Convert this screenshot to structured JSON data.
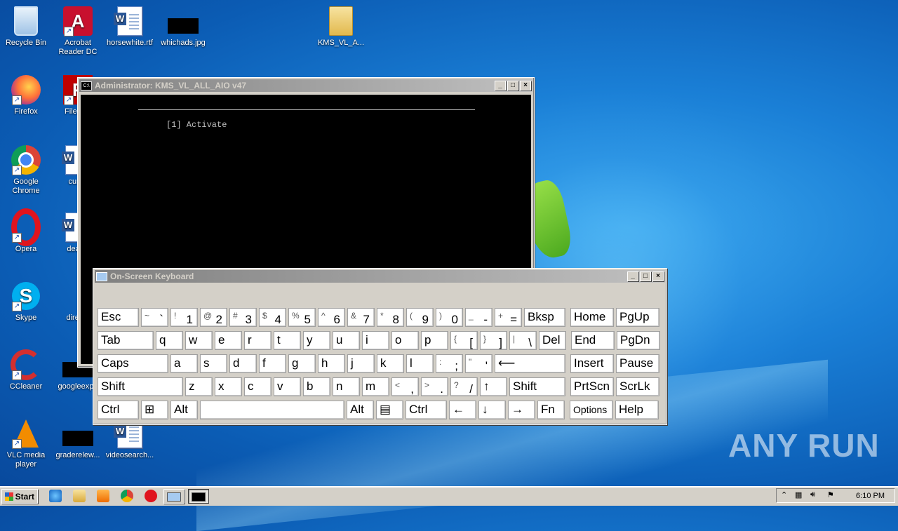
{
  "desktop": {
    "icons": [
      {
        "label": "Recycle Bin"
      },
      {
        "label": "Acrobat Reader DC"
      },
      {
        "label": "horsewhite.rtf"
      },
      {
        "label": "whichads.jpg"
      },
      {
        "label": "KMS_VL_A..."
      },
      {
        "label": "Firefox"
      },
      {
        "label": "FileZilla"
      },
      {
        "label": "Google Chrome"
      },
      {
        "label": "cumu"
      },
      {
        "label": "Opera"
      },
      {
        "label": "deathr"
      },
      {
        "label": "Skype"
      },
      {
        "label": "directo"
      },
      {
        "label": "CCleaner"
      },
      {
        "label": "googleexpe"
      },
      {
        "label": "VLC media player"
      },
      {
        "label": "graderelew..."
      },
      {
        "label": "videosearch..."
      }
    ]
  },
  "console": {
    "title": "Administrator:  KMS_VL_ALL_AIO v47",
    "icon_text": "C:\\",
    "menu_item": "[1] Activate"
  },
  "osk": {
    "title": "On-Screen Keyboard",
    "rows": [
      [
        "Esc",
        "`",
        "1",
        "2",
        "3",
        "4",
        "5",
        "6",
        "7",
        "8",
        "9",
        "0",
        "-",
        "=",
        "Bksp",
        "Home",
        "PgUp"
      ],
      [
        "Tab",
        "q",
        "w",
        "e",
        "r",
        "t",
        "y",
        "u",
        "i",
        "o",
        "p",
        "[",
        "]",
        "\\",
        "Del",
        "End",
        "PgDn"
      ],
      [
        "Caps",
        "a",
        "s",
        "d",
        "f",
        "g",
        "h",
        "j",
        "k",
        "l",
        ";",
        "'",
        "Enter",
        "Insert",
        "Pause"
      ],
      [
        "Shift",
        "z",
        "x",
        "c",
        "v",
        "b",
        "n",
        "m",
        ",",
        ".",
        "/",
        "↑",
        "Shift",
        "PrtScn",
        "ScrLk"
      ],
      [
        "Ctrl",
        "Win",
        "Alt",
        "",
        "Alt",
        "Menu",
        "Ctrl",
        "←",
        "↓",
        "→",
        "Fn",
        "Options",
        "Help"
      ]
    ],
    "shift_chars": {
      "`": "~",
      "1": "!",
      "2": "@",
      "3": "#",
      "4": "$",
      "5": "%",
      "6": "^",
      "7": "&",
      "8": "*",
      "9": "(",
      "0": ")",
      "-": "_",
      "=": "+",
      "[": "{",
      "]": "}",
      "\\": "|",
      ";": ":",
      "'": "\"",
      ",": "<",
      ".": ">",
      "/": "?"
    }
  },
  "taskbar": {
    "start_label": "Start",
    "clock": "6:10 PM"
  },
  "watermark": "ANY RUN",
  "colors": {
    "titlebar_active": "#0a246a",
    "titlebar_inactive": "#808080",
    "desktop": "#1a7fd6"
  }
}
